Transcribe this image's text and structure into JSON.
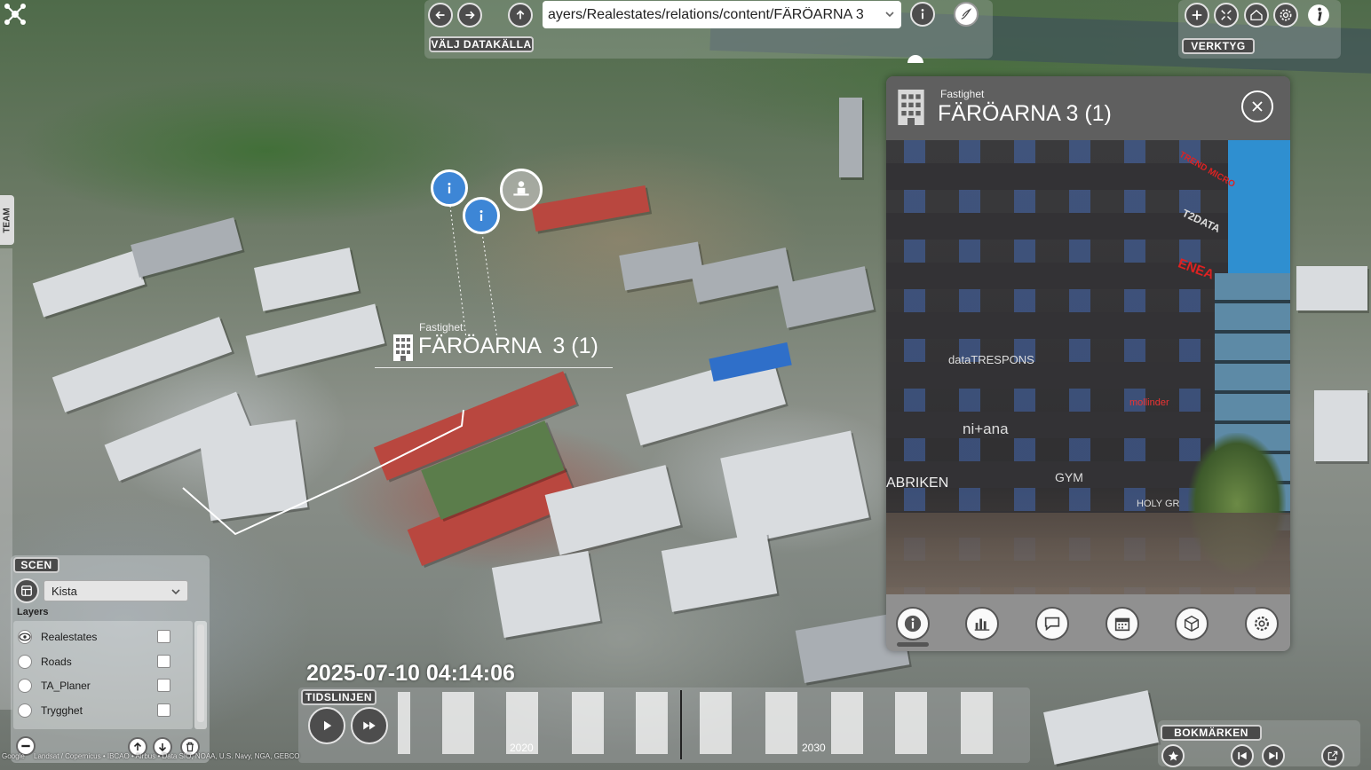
{
  "topbar": {
    "source_label": "VÄLJ DATAKÄLLA",
    "url_value": "ayers/Realestates/relations/content/FÄRÖARNA 3",
    "tools_label": "VERKTYG"
  },
  "side_tab": {
    "label": "TEAM"
  },
  "map_label": {
    "category": "Fastighet",
    "name": "FÄRÖARNA  3 (1)"
  },
  "property_panel": {
    "category": "Fastighet",
    "title": "FÄRÖARNA 3 (1)",
    "photo_signs": [
      "dataTRESPONS",
      "ni+ana",
      "ABRIKEN",
      "GYM",
      "HOLY GR",
      "ENEA",
      "T2DATA",
      "TREND MICRO",
      "mollinder"
    ],
    "tools": [
      "info-icon",
      "chart-icon",
      "chat-icon",
      "calendar-icon",
      "cube-icon",
      "gear-icon"
    ]
  },
  "scene": {
    "label": "SCEN",
    "selected": "Kista",
    "layers_heading": "Layers",
    "layers": [
      {
        "name": "Realestates",
        "visible_icon": "eye-icon"
      },
      {
        "name": "Roads"
      },
      {
        "name": "TA_Planer"
      },
      {
        "name": "Trygghet"
      }
    ]
  },
  "timeline": {
    "datetime": "2025-07-10 04:14:06",
    "label": "TIDSLINJEN",
    "years": [
      "2020",
      "2030"
    ]
  },
  "bookmarks": {
    "label": "BOKMÄRKEN"
  },
  "attribution": {
    "google": "Google",
    "text": "Landsat / Copernicus  •  IBCAO  •  Airbus  •  Data SIO, NOAA, U.S. Navy, NGA, GEBCO"
  },
  "colors": {
    "panel": "#6a6a6a",
    "pill": "#4a4a4a",
    "red_roof": "#b9473f"
  }
}
